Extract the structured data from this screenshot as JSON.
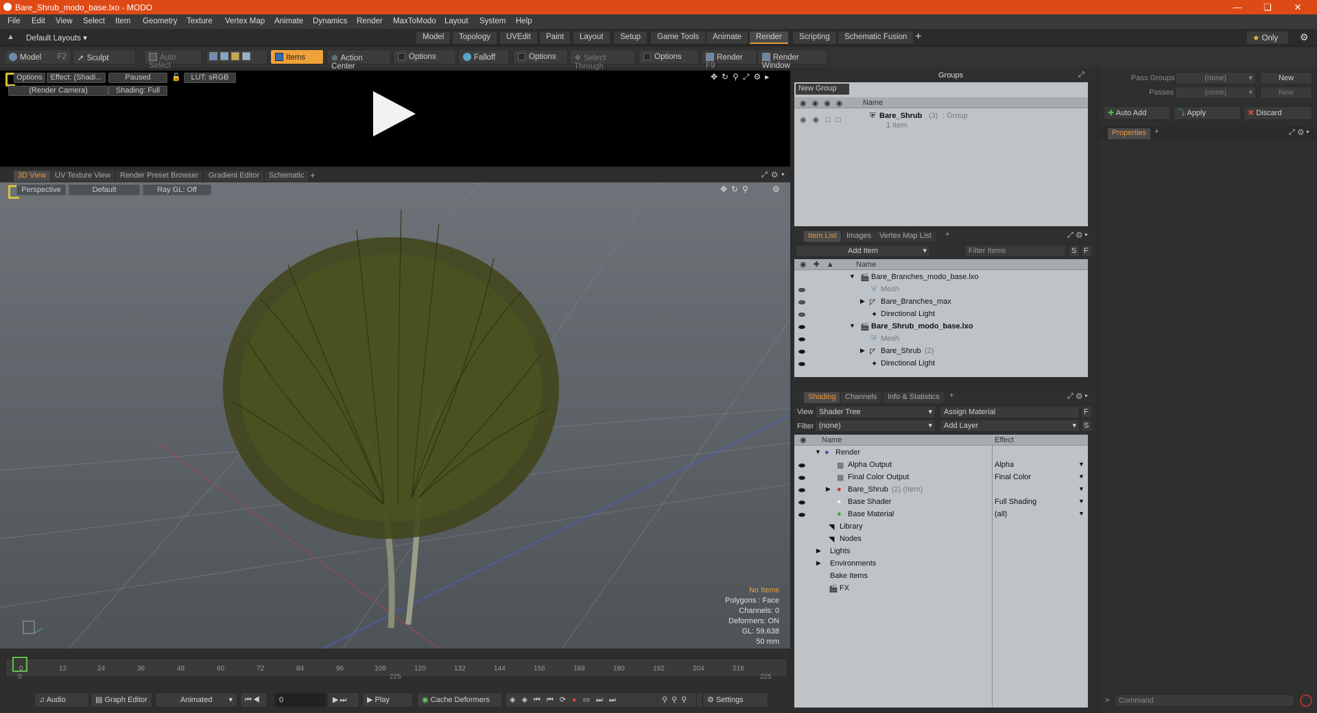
{
  "window": {
    "title": "Bare_Shrub_modo_base.lxo - MODO"
  },
  "menu": [
    "File",
    "Edit",
    "View",
    "Select",
    "Item",
    "Geometry",
    "Texture",
    "Vertex Map",
    "Animate",
    "Dynamics",
    "Render",
    "MaxToModo",
    "Layout",
    "System",
    "Help"
  ],
  "layout": {
    "dropdown": "Default Layouts",
    "tabs": [
      "Model",
      "Topology",
      "UVEdit",
      "Paint",
      "Layout",
      "Setup",
      "Game Tools",
      "Animate",
      "Render",
      "Scripting",
      "Schematic Fusion"
    ],
    "active_tab": "Render",
    "only_label": "Only"
  },
  "toolbar": {
    "model": "Model",
    "model_key": "F2",
    "sculpt": "Sculpt",
    "auto_select": "Auto Select",
    "items": "Items",
    "action_center": "Action Center",
    "options1": "Options",
    "falloff": "Falloff",
    "options2": "Options",
    "select_through": "Select Through",
    "options3": "Options",
    "render": "Render",
    "render_key": "F9",
    "render_window": "Render Window"
  },
  "preview": {
    "options": "Options",
    "effect": "Effect: (Shadi...",
    "paused": "Paused",
    "lut": "LUT: sRGB",
    "camera": "(Render Camera)",
    "shading": "Shading: Full"
  },
  "viewport_tabs": [
    "3D View",
    "UV Texture View",
    "Render Preset Browser",
    "Gradient Editor",
    "Schematic"
  ],
  "viewport": {
    "perspective": "Perspective",
    "default": "Default",
    "raygl": "Ray GL: Off",
    "hud": {
      "no_items": "No Items",
      "polygons": "Polygons : Face",
      "channels": "Channels: 0",
      "deformers": "Deformers: ON",
      "gl": "GL: 59,638",
      "focal": "50 mm"
    }
  },
  "timeline": {
    "ticks": [
      "0",
      "12",
      "24",
      "36",
      "48",
      "60",
      "72",
      "84",
      "96",
      "108",
      "120",
      "132",
      "144",
      "156",
      "168",
      "180",
      "192",
      "204",
      "216"
    ],
    "lower_left": "0",
    "lower_mid": "225",
    "lower_right": "225"
  },
  "transport": {
    "audio": "Audio",
    "graph_editor": "Graph Editor",
    "animated": "Animated",
    "frame": "0",
    "play": "Play",
    "cache": "Cache Deformers",
    "settings": "Settings"
  },
  "groups": {
    "title": "Groups",
    "new_group": "New Group",
    "col_name": "Name",
    "item_name": "Bare_Shrub",
    "item_count": "(3)",
    "item_type": ": Group",
    "item_sub": "1 Item"
  },
  "itemlist": {
    "tabs": [
      "Item List",
      "Images",
      "Vertex Map List"
    ],
    "add_item": "Add Item",
    "filter": "Filter Items",
    "s": "S",
    "f": "F",
    "col_name": "Name",
    "rows": [
      {
        "label": "Bare_Branches_modo_base.lxo",
        "style": "normal"
      },
      {
        "label": "Mesh",
        "style": "gray"
      },
      {
        "label": "Bare_Branches_max",
        "style": "normal"
      },
      {
        "label": "Directional Light",
        "style": "normal"
      },
      {
        "label": "Bare_Shrub_modo_base.lxo",
        "style": "bold"
      },
      {
        "label": "Mesh",
        "style": "gray"
      },
      {
        "label": "Bare_Shrub",
        "style": "normal",
        "suffix": "(2)"
      },
      {
        "label": "Directional Light",
        "style": "normal"
      }
    ]
  },
  "shading": {
    "tabs": [
      "Shading",
      "Channels",
      "Info & Statistics"
    ],
    "view_label": "View",
    "view_value": "Shader Tree",
    "assign": "Assign Material",
    "filter_label": "Filter",
    "filter_value": "(none)",
    "add_layer": "Add Layer",
    "col_name": "Name",
    "col_effect": "Effect",
    "rows": [
      {
        "label": "Render",
        "effect": ""
      },
      {
        "label": "Alpha Output",
        "effect": "Alpha"
      },
      {
        "label": "Final Color Output",
        "effect": "Final Color"
      },
      {
        "label": "Bare_Shrub",
        "suffix": "(2) (Item)",
        "effect": ""
      },
      {
        "label": "Base Shader",
        "effect": "Full Shading"
      },
      {
        "label": "Base Material",
        "effect": "(all)"
      },
      {
        "label": "Library",
        "effect": ""
      },
      {
        "label": "Nodes",
        "effect": ""
      },
      {
        "label": "Lights",
        "effect": ""
      },
      {
        "label": "Environments",
        "effect": ""
      },
      {
        "label": "Bake Items",
        "effect": ""
      },
      {
        "label": "FX",
        "effect": ""
      }
    ]
  },
  "passes": {
    "pass_groups": "Pass Groups",
    "passes": "Passes",
    "none1": "(none)",
    "none2": "(none)",
    "new1": "New",
    "new2": "New",
    "auto_add": "Auto Add",
    "apply": "Apply",
    "discard": "Discard",
    "properties": "Properties",
    "command": "Command"
  },
  "colors": {
    "title_bar": "#de4a16",
    "accent": "#e8963a",
    "panel_bg": "#bec3c7"
  }
}
